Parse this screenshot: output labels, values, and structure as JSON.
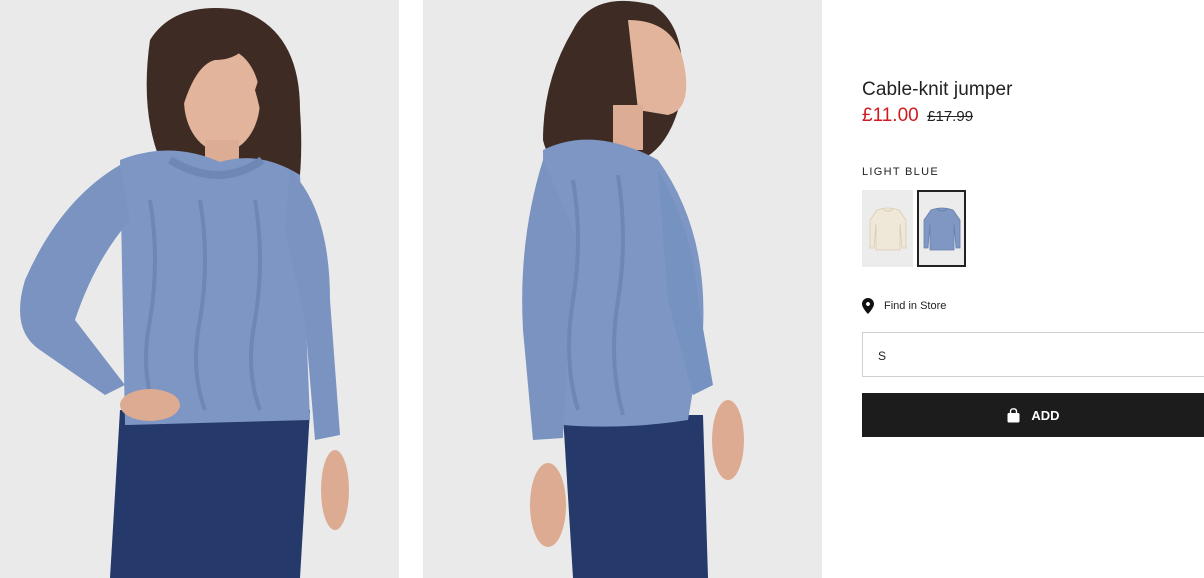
{
  "product": {
    "name": "Cable-knit jumper",
    "sale_price": "£11.00",
    "original_price": "£17.99",
    "selected_color_label": "LIGHT BLUE",
    "swatches": [
      {
        "color_name": "light beige",
        "hex": "#efe7d7",
        "selected": false
      },
      {
        "color_name": "light blue",
        "hex": "#7f97c2",
        "selected": true
      }
    ],
    "find_in_store_label": "Find in Store",
    "size_value": "S",
    "add_label": "ADD"
  },
  "colors": {
    "sale_red": "#d01a1f",
    "button_black": "#1c1c1c",
    "sweater_blue": "#7d96c4",
    "denim": "#25396b",
    "photo_bg": "#eaeaea"
  },
  "icons": {
    "location": "location-pin-icon",
    "bag": "shopping-bag-icon"
  }
}
